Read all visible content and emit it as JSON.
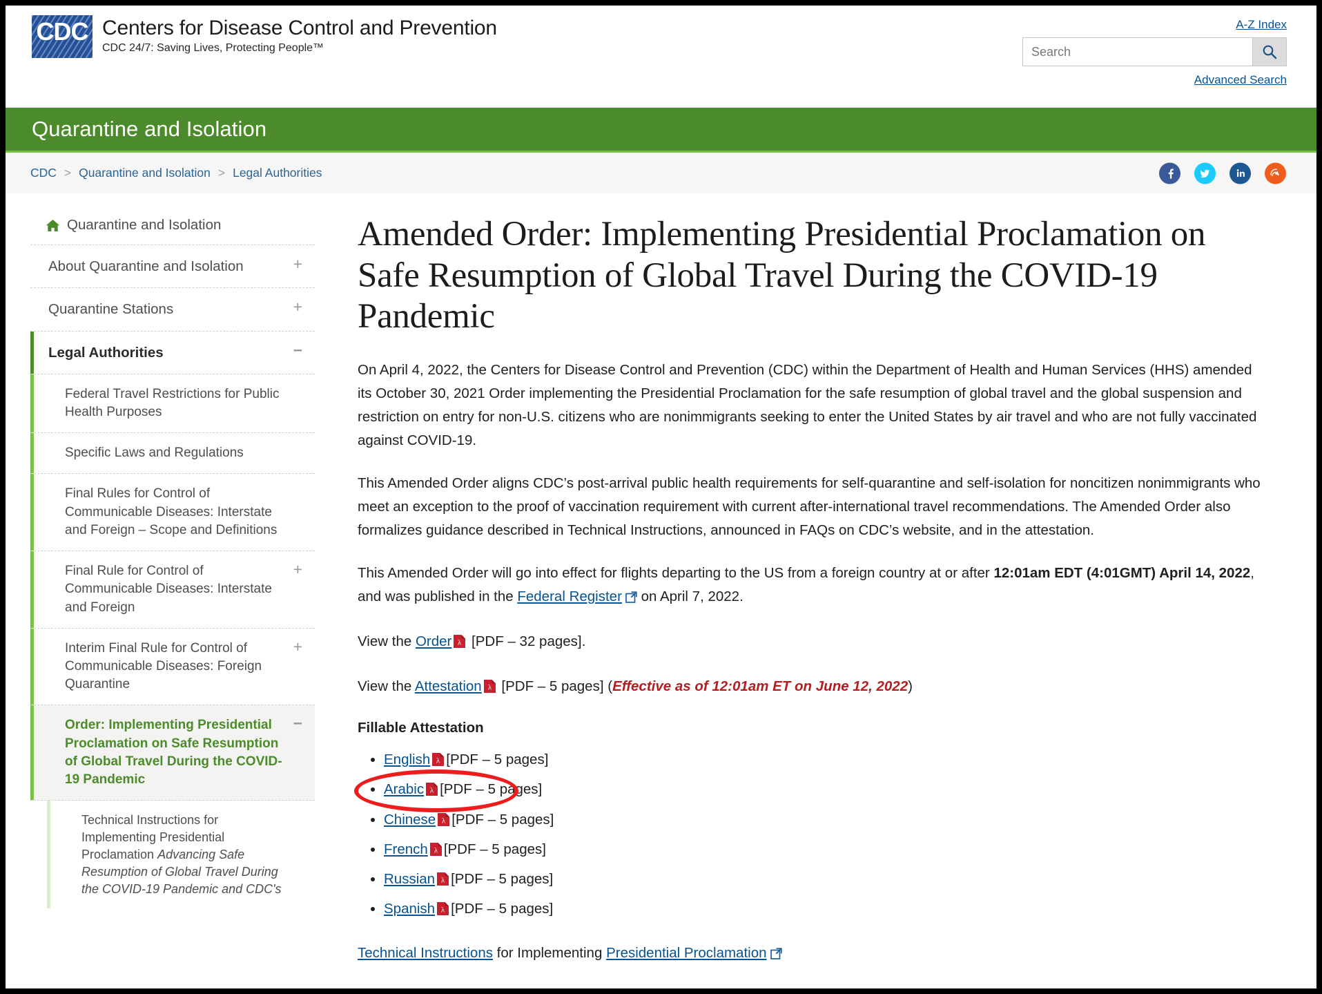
{
  "header": {
    "logo_letters": "CDC",
    "agency_name": "Centers for Disease Control and Prevention",
    "tagline": "CDC 24/7: Saving Lives, Protecting People™",
    "az_index": "A-Z Index",
    "search_placeholder": "Search",
    "search_value": "",
    "advanced_search": "Advanced Search",
    "search_icon": "search-icon"
  },
  "banner": {
    "title": "Quarantine and Isolation"
  },
  "breadcrumb": {
    "items": [
      {
        "label": "CDC"
      },
      {
        "label": "Quarantine and Isolation"
      },
      {
        "label": "Legal Authorities"
      }
    ],
    "separator": ">"
  },
  "socials": [
    {
      "name": "facebook-icon",
      "glyph": "f",
      "color": "#3b5998"
    },
    {
      "name": "twitter-icon",
      "glyph": "t",
      "color": "#1dcaff"
    },
    {
      "name": "linkedin-icon",
      "glyph": "in",
      "color": "#1d5892"
    },
    {
      "name": "syndicate-icon",
      "glyph": "s",
      "color": "#ee5c1e"
    }
  ],
  "sidebar": {
    "home_label": "Quarantine and Isolation",
    "home_icon": "home-icon",
    "items": [
      {
        "label": "About Quarantine and Isolation",
        "toggle": "+"
      },
      {
        "label": "Quarantine Stations",
        "toggle": "+"
      },
      {
        "label": "Legal Authorities",
        "toggle": "−",
        "active": true
      }
    ],
    "sub_items": [
      {
        "label": "Federal Travel Restrictions for Public Health Purposes",
        "toggle": ""
      },
      {
        "label": "Specific Laws and Regulations",
        "toggle": ""
      },
      {
        "label": "Final Rules for Control of Communicable Diseases: Interstate and Foreign – Scope and Definitions",
        "toggle": ""
      },
      {
        "label": "Final Rule for Control of Communicable Diseases: Interstate and Foreign",
        "toggle": "+"
      },
      {
        "label": "Interim Final Rule for Control of Communicable Diseases: Foreign Quarantine",
        "toggle": "+"
      },
      {
        "label": "Order: Implementing Presidential Proclamation on Safe Resumption of Global Travel During the COVID-19 Pandemic",
        "toggle": "−",
        "current": true
      }
    ],
    "sub_sub_items": [
      {
        "text_before": "Technical Instructions for Implementing Presidential Proclamation ",
        "text_italic": "Advancing Safe Resumption of Global Travel During the COVID-19 Pandemic",
        "text_after": " and CDC's"
      }
    ]
  },
  "main": {
    "title": "Amended Order: Implementing Presidential Proclamation on Safe Resumption of Global Travel During the COVID‑19 Pandemic",
    "paragraph_1": "On April 4, 2022, the Centers for Disease Control and Prevention (CDC) within the Department of Health and Human Services (HHS) amended its October 30, 2021 Order implementing the Presidential Proclamation for the safe resumption of global travel and the global suspension and restriction on entry for non-U.S. citizens who are nonimmigrants seeking to enter the United States by air travel and who are not fully vaccinated against COVID-19.",
    "paragraph_2": "This Amended Order aligns CDC’s post-arrival public health requirements for self-quarantine and self-isolation for noncitizen nonimmigrants who meet an exception to the proof of vaccination requirement with current after-international travel recommendations. The Amended Order also formalizes guidance described in Technical Instructions, announced in FAQs on CDC’s website, and in the attestation.",
    "paragraph_3": {
      "part_1": "This Amended Order will go into effect for flights departing to the US from a foreign country at or after ",
      "bold_1": "12:01am EDT (4:01GMT) April 14, 2022",
      "part_2": ", and was published in the ",
      "link_1": "Federal Register",
      "part_3": " on April 7, 2022."
    },
    "order_line": {
      "prefix": "View the ",
      "link": "Order",
      "suffix": " [PDF – 32 pages]."
    },
    "attestation_line": {
      "prefix": "View the ",
      "link": "Attestation",
      "suffix": " [PDF – 5 pages] (",
      "note": "Effective as of 12:01am ET on June 12, 2022",
      "close": ")"
    },
    "fillable_heading": "Fillable Attestation",
    "fillable_items": [
      {
        "language": "English",
        "meta": "[PDF – 5 pages]"
      },
      {
        "language": "Arabic",
        "meta": "[PDF – 5 pages]"
      },
      {
        "language": "Chinese",
        "meta": "[PDF – 5 pages]"
      },
      {
        "language": "French",
        "meta": "[PDF – 5 pages]"
      },
      {
        "language": "Russian",
        "meta": "[PDF – 5 pages]"
      },
      {
        "language": "Spanish",
        "meta": "[PDF – 5 pages]"
      }
    ],
    "tech_line": {
      "link_1": "Technical Instructions",
      "middle": " for Implementing ",
      "link_2": "Presidential Proclamation"
    }
  },
  "annotation": {
    "shape": "ellipse",
    "color": "#ee1c1c",
    "targets": "English fillable attestation link"
  }
}
